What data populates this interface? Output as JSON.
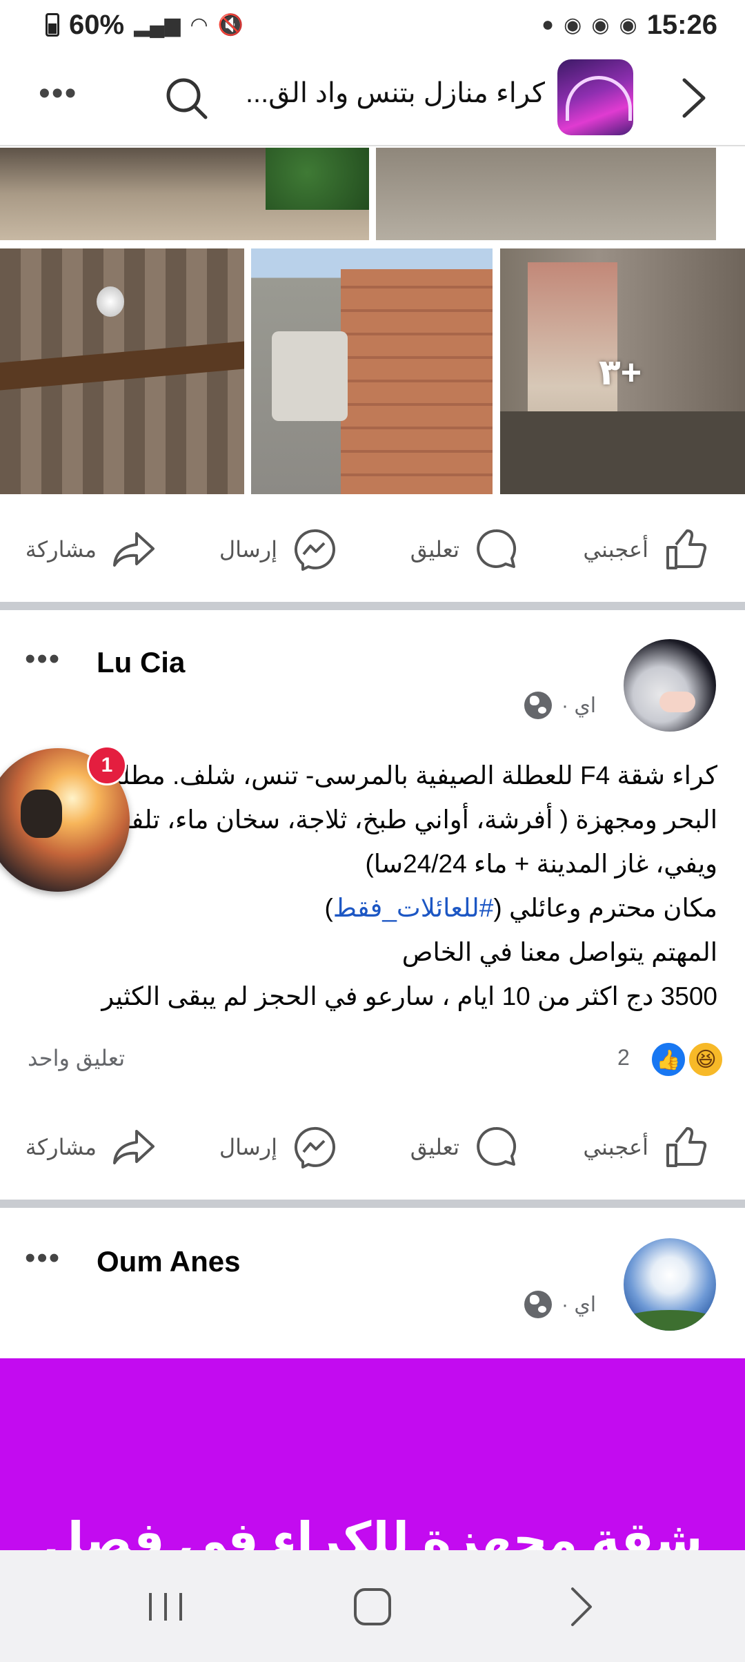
{
  "status_bar": {
    "battery": "60%",
    "time": "15:26"
  },
  "header": {
    "group_title": "كراء منازل بتنس واد الق...",
    "icons": [
      "more-icon",
      "search-icon",
      "back-chevron-icon"
    ]
  },
  "post1": {
    "photos_more": "+٣",
    "actions": {
      "like": "أعجبني",
      "comment": "تعليق",
      "send": "إرسال",
      "share": "مشاركة"
    }
  },
  "post2": {
    "author": "Lu Cia",
    "meta": "اي ·",
    "body_lines": [
      "كراء شقة F4 للعطلة الصيفية بالمرسى- تنس، شلف. مطلة على",
      "البحر ومجهزة ( أفرشة، أواني طبخ، ثلاجة، سخان ماء، تلفاز،",
      "ويفي، غاز المدينة + ماء 24/24سا)",
      "مكان محترم وعائلي (",
      "المهتم يتواصل معنا في الخاص",
      "3500 دج اكثر من 10 ايام ، سارعو في الحجز لم يبقى الكثير"
    ],
    "hashtag": "#للعائلات_فقط",
    "hashtag_close": ")",
    "reaction_count": "2",
    "comment_count": "تعليق واحد",
    "actions": {
      "like": "أعجبني",
      "comment": "تعليق",
      "send": "إرسال",
      "share": "مشاركة"
    }
  },
  "chat_head": {
    "badge": "1"
  },
  "post3": {
    "author": "Oum Anes",
    "meta": "اي ·",
    "banner_text": "شقة مجهزة للكراء في فصل"
  },
  "colors": {
    "banner": "#c30bf0",
    "link": "#1d57c4",
    "like_blue": "#1877f2",
    "badge_red": "#e41e3f"
  }
}
